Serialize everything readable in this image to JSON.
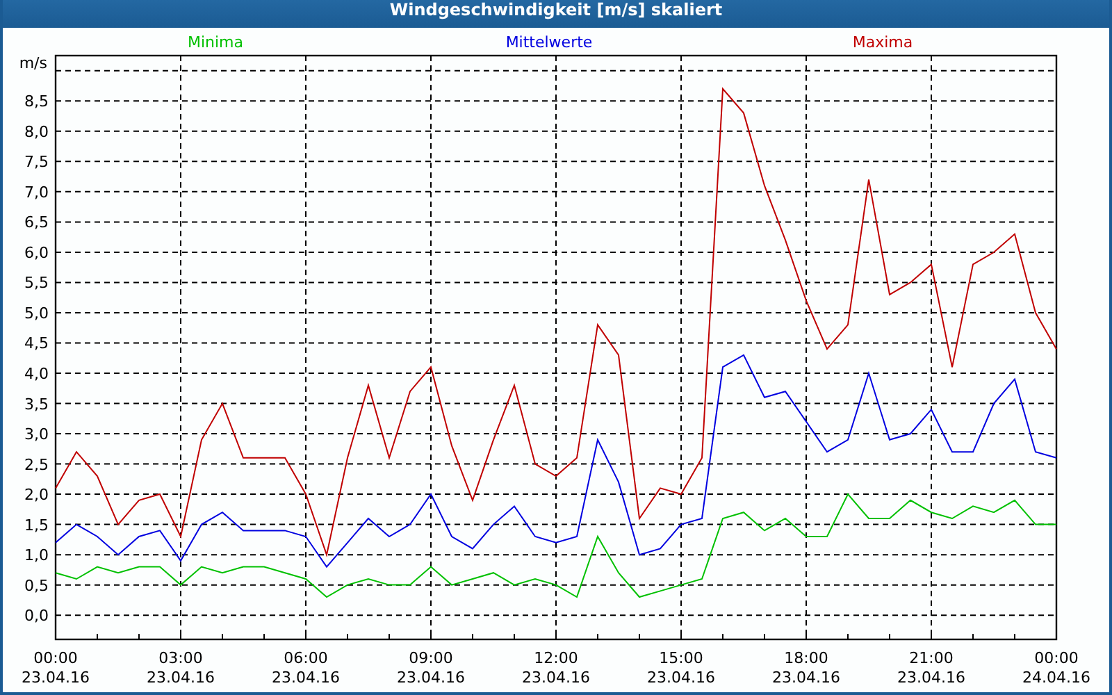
{
  "window": {
    "title": "Windgeschwindigkeit [m/s] skaliert"
  },
  "chart": {
    "chart_data": {
      "type": "line",
      "ylabel": "m/s",
      "grid": true,
      "ylim": [
        -0.4,
        9.25
      ],
      "categories": [
        "00:00\n23.04.16",
        null,
        null,
        null,
        null,
        null,
        "03:00\n23.04.16",
        null,
        null,
        null,
        null,
        null,
        "06:00\n23.04.16",
        null,
        null,
        null,
        null,
        null,
        "09:00\n23.04.16",
        null,
        null,
        null,
        null,
        null,
        "12:00\n23.04.16",
        null,
        null,
        null,
        null,
        null,
        "15:00\n23.04.16",
        null,
        null,
        null,
        null,
        null,
        "18:00\n23.04.16",
        null,
        null,
        null,
        null,
        null,
        "21:00\n23.04.16",
        null,
        null,
        null,
        null,
        null,
        "00:00\n24.04.16"
      ],
      "yticks": [
        {
          "value": 0,
          "label": "0,0"
        },
        {
          "value": 0.5,
          "label": "0,5"
        },
        {
          "value": 1,
          "label": "1,0"
        },
        {
          "value": 1.5,
          "label": "1,5"
        },
        {
          "value": 2,
          "label": "2,0"
        },
        {
          "value": 2.5,
          "label": "2,5"
        },
        {
          "value": 3,
          "label": "3,0"
        },
        {
          "value": 3.5,
          "label": "3,5"
        },
        {
          "value": 4,
          "label": "4,0"
        },
        {
          "value": 4.5,
          "label": "4,5"
        },
        {
          "value": 5,
          "label": "5,0"
        },
        {
          "value": 5.5,
          "label": "5,5"
        },
        {
          "value": 6,
          "label": "6,0"
        },
        {
          "value": 6.5,
          "label": "6,5"
        },
        {
          "value": 7,
          "label": "7,0"
        },
        {
          "value": 7.5,
          "label": "7,5"
        },
        {
          "value": 8,
          "label": "8,0"
        },
        {
          "value": 8.5,
          "label": "8,5"
        }
      ],
      "series": [
        {
          "name": "Minima",
          "color": "#00c000",
          "values": [
            0.7,
            0.6,
            0.8,
            0.7,
            0.8,
            0.8,
            0.5,
            0.8,
            0.7,
            0.8,
            0.8,
            0.7,
            0.6,
            0.3,
            0.5,
            0.6,
            0.5,
            0.5,
            0.8,
            0.5,
            0.6,
            0.7,
            0.5,
            0.6,
            0.5,
            0.3,
            1.3,
            0.7,
            0.3,
            0.4,
            0.5,
            0.6,
            1.6,
            1.7,
            1.4,
            1.6,
            1.3,
            1.3,
            2.0,
            1.6,
            1.6,
            1.9,
            1.7,
            1.6,
            1.8,
            1.7,
            1.9,
            1.5,
            1.5
          ]
        },
        {
          "name": "Mittelwerte",
          "color": "#0000e0",
          "values": [
            1.2,
            1.5,
            1.3,
            1.0,
            1.3,
            1.4,
            0.9,
            1.5,
            1.7,
            1.4,
            1.4,
            1.4,
            1.3,
            0.8,
            1.2,
            1.6,
            1.3,
            1.5,
            2.0,
            1.3,
            1.1,
            1.5,
            1.8,
            1.3,
            1.2,
            1.3,
            2.9,
            2.2,
            1.0,
            1.1,
            1.5,
            1.6,
            4.1,
            4.3,
            3.6,
            3.7,
            3.2,
            2.7,
            2.9,
            4.0,
            2.9,
            3.0,
            3.4,
            2.7,
            2.7,
            3.5,
            3.9,
            2.7,
            2.6
          ]
        },
        {
          "name": "Maxima",
          "color": "#c00000",
          "values": [
            2.1,
            2.7,
            2.3,
            1.5,
            1.9,
            2.0,
            1.3,
            2.9,
            3.5,
            2.6,
            2.6,
            2.6,
            2.0,
            1.0,
            2.6,
            3.8,
            2.6,
            3.7,
            4.1,
            2.8,
            1.9,
            2.9,
            3.8,
            2.5,
            2.3,
            2.6,
            4.8,
            4.3,
            1.6,
            2.1,
            2.0,
            2.6,
            8.7,
            8.3,
            7.1,
            6.2,
            5.2,
            4.4,
            4.8,
            7.2,
            5.3,
            5.5,
            5.8,
            4.1,
            5.8,
            6.0,
            6.3,
            5.0,
            4.4
          ]
        }
      ]
    }
  }
}
